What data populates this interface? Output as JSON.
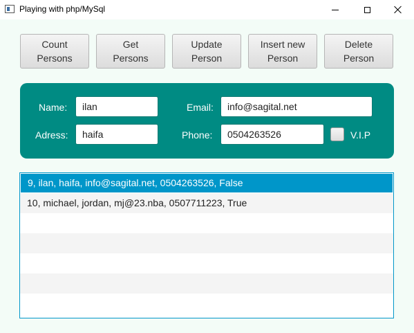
{
  "window": {
    "title": "Playing with php/MySql"
  },
  "toolbar": {
    "buttons": [
      {
        "label": "Count\nPersons"
      },
      {
        "label": "Get\nPersons"
      },
      {
        "label": "Update\nPerson"
      },
      {
        "label": "Insert new\nPerson"
      },
      {
        "label": "Delete\nPerson"
      }
    ]
  },
  "form": {
    "name_label": "Name:",
    "name_value": "ilan",
    "email_label": "Email:",
    "email_value": "info@sagital.net",
    "address_label": "Adress:",
    "address_value": "haifa",
    "phone_label": "Phone:",
    "phone_value": "0504263526",
    "vip_label": "V.I.P",
    "vip_checked": false,
    "panel_color": "#008b83"
  },
  "list": {
    "items": [
      "9, ilan, haifa, info@sagital.net, 0504263526, False",
      "10, michael, jordan, mj@23.nba, 0507711223, True"
    ],
    "selected_index": 0,
    "selection_color": "#0096c9"
  }
}
